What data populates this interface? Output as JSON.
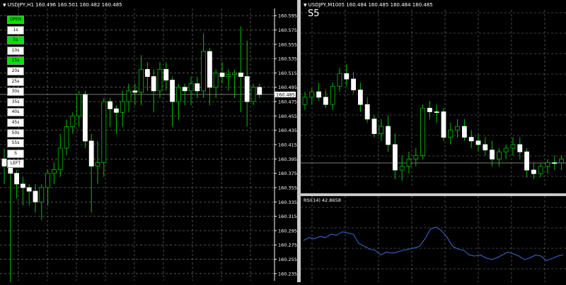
{
  "left_chart": {
    "header": "USDJPY,H1  160.496 160.501 160.482 160.485",
    "current_price": "160.485",
    "price_ticks": [
      "160.595",
      "160.575",
      "160.555",
      "160.535",
      "160.515",
      "160.495",
      "160.475",
      "160.455",
      "160.435",
      "160.415",
      "160.395",
      "160.375",
      "160.355",
      "160.335",
      "160.315",
      "160.295",
      "160.275",
      "160.255",
      "160.235"
    ],
    "timeframe_buttons": [
      {
        "label": "OPEN",
        "active": true
      },
      {
        "label": "1s",
        "active": false
      },
      {
        "label": "5s",
        "active": true
      },
      {
        "label": "10s",
        "active": false
      },
      {
        "label": "15s",
        "active": true
      },
      {
        "label": "20s",
        "active": false
      },
      {
        "label": "25s",
        "active": false
      },
      {
        "label": "30s",
        "active": false
      },
      {
        "label": "35s",
        "active": false
      },
      {
        "label": "40s",
        "active": false
      },
      {
        "label": "45s",
        "active": false
      },
      {
        "label": "50s",
        "active": false
      },
      {
        "label": "55s",
        "active": false
      },
      {
        "label": "S",
        "active": false
      },
      {
        "label": "LEFT",
        "active": false
      }
    ],
    "colors": {
      "bull": "#00c000",
      "bear": "#ffffff",
      "grid": "#808080",
      "price_line": "#a0a0a0"
    }
  },
  "right_chart": {
    "header": "USDJPY,M1005  160.484 160.485 160.484 160.485",
    "label": "S5",
    "rsi_header": "RSI(14) 42.8658",
    "colors": {
      "rsi_line": "#3a6fd8"
    }
  },
  "chart_data": [
    {
      "type": "candlestick",
      "title": "USDJPY,H1",
      "ylim": [
        160.225,
        160.605
      ],
      "candles": [
        {
          "o": 160.395,
          "h": 160.41,
          "l": 160.36,
          "c": 160.385
        },
        {
          "o": 160.385,
          "h": 160.39,
          "l": 160.22,
          "c": 160.375
        },
        {
          "o": 160.375,
          "h": 160.38,
          "l": 160.34,
          "c": 160.36
        },
        {
          "o": 160.36,
          "h": 160.37,
          "l": 160.33,
          "c": 160.355
        },
        {
          "o": 160.355,
          "h": 160.36,
          "l": 160.33,
          "c": 160.35
        },
        {
          "o": 160.35,
          "h": 160.36,
          "l": 160.32,
          "c": 160.335
        },
        {
          "o": 160.335,
          "h": 160.36,
          "l": 160.31,
          "c": 160.355
        },
        {
          "o": 160.355,
          "h": 160.38,
          "l": 160.33,
          "c": 160.375
        },
        {
          "o": 160.375,
          "h": 160.39,
          "l": 160.36,
          "c": 160.38
        },
        {
          "o": 160.38,
          "h": 160.43,
          "l": 160.37,
          "c": 160.41
        },
        {
          "o": 160.41,
          "h": 160.45,
          "l": 160.4,
          "c": 160.44
        },
        {
          "o": 160.44,
          "h": 160.46,
          "l": 160.43,
          "c": 160.455
        },
        {
          "o": 160.455,
          "h": 160.49,
          "l": 160.44,
          "c": 160.485
        },
        {
          "o": 160.485,
          "h": 160.49,
          "l": 160.41,
          "c": 160.42
        },
        {
          "o": 160.42,
          "h": 160.43,
          "l": 160.32,
          "c": 160.385
        },
        {
          "o": 160.385,
          "h": 160.42,
          "l": 160.36,
          "c": 160.39
        },
        {
          "o": 160.39,
          "h": 160.48,
          "l": 160.37,
          "c": 160.475
        },
        {
          "o": 160.475,
          "h": 160.48,
          "l": 160.44,
          "c": 160.465
        },
        {
          "o": 160.465,
          "h": 160.47,
          "l": 160.43,
          "c": 160.46
        },
        {
          "o": 160.46,
          "h": 160.49,
          "l": 160.44,
          "c": 160.475
        },
        {
          "o": 160.475,
          "h": 160.5,
          "l": 160.46,
          "c": 160.49
        },
        {
          "o": 160.49,
          "h": 160.5,
          "l": 160.47,
          "c": 160.488
        },
        {
          "o": 160.488,
          "h": 160.54,
          "l": 160.47,
          "c": 160.52
        },
        {
          "o": 160.52,
          "h": 160.53,
          "l": 160.49,
          "c": 160.51
        },
        {
          "o": 160.51,
          "h": 160.52,
          "l": 160.46,
          "c": 160.49
        },
        {
          "o": 160.49,
          "h": 160.53,
          "l": 160.48,
          "c": 160.52
        },
        {
          "o": 160.52,
          "h": 160.53,
          "l": 160.49,
          "c": 160.505
        },
        {
          "o": 160.505,
          "h": 160.51,
          "l": 160.44,
          "c": 160.475
        },
        {
          "o": 160.475,
          "h": 160.5,
          "l": 160.45,
          "c": 160.495
        },
        {
          "o": 160.495,
          "h": 160.5,
          "l": 160.47,
          "c": 160.49
        },
        {
          "o": 160.49,
          "h": 160.51,
          "l": 160.47,
          "c": 160.5
        },
        {
          "o": 160.5,
          "h": 160.51,
          "l": 160.48,
          "c": 160.49
        },
        {
          "o": 160.49,
          "h": 160.57,
          "l": 160.48,
          "c": 160.545
        },
        {
          "o": 160.545,
          "h": 160.55,
          "l": 160.47,
          "c": 160.495
        },
        {
          "o": 160.495,
          "h": 160.52,
          "l": 160.48,
          "c": 160.515
        },
        {
          "o": 160.515,
          "h": 160.53,
          "l": 160.5,
          "c": 160.51
        },
        {
          "o": 160.51,
          "h": 160.52,
          "l": 160.49,
          "c": 160.513
        },
        {
          "o": 160.513,
          "h": 160.52,
          "l": 160.48,
          "c": 160.515
        },
        {
          "o": 160.515,
          "h": 160.58,
          "l": 160.46,
          "c": 160.51
        },
        {
          "o": 160.51,
          "h": 160.56,
          "l": 160.44,
          "c": 160.475
        },
        {
          "o": 160.475,
          "h": 160.5,
          "l": 160.47,
          "c": 160.495
        },
        {
          "o": 160.495,
          "h": 160.5,
          "l": 160.48,
          "c": 160.485
        }
      ]
    },
    {
      "type": "candlestick",
      "title": "USDJPY,M1005",
      "label": "S5",
      "candles": [
        {
          "o": 0.52,
          "h": 0.45,
          "l": 0.55,
          "c": 0.48
        },
        {
          "o": 0.48,
          "h": 0.43,
          "l": 0.52,
          "c": 0.45
        },
        {
          "o": 0.45,
          "h": 0.4,
          "l": 0.5,
          "c": 0.48
        },
        {
          "o": 0.48,
          "h": 0.44,
          "l": 0.54,
          "c": 0.52
        },
        {
          "o": 0.52,
          "h": 0.4,
          "l": 0.55,
          "c": 0.42
        },
        {
          "o": 0.42,
          "h": 0.32,
          "l": 0.45,
          "c": 0.35
        },
        {
          "o": 0.35,
          "h": 0.3,
          "l": 0.42,
          "c": 0.38
        },
        {
          "o": 0.38,
          "h": 0.34,
          "l": 0.46,
          "c": 0.44
        },
        {
          "o": 0.44,
          "h": 0.4,
          "l": 0.56,
          "c": 0.52
        },
        {
          "o": 0.52,
          "h": 0.48,
          "l": 0.62,
          "c": 0.6
        },
        {
          "o": 0.6,
          "h": 0.58,
          "l": 0.7,
          "c": 0.68
        },
        {
          "o": 0.68,
          "h": 0.6,
          "l": 0.72,
          "c": 0.64
        },
        {
          "o": 0.64,
          "h": 0.58,
          "l": 0.78,
          "c": 0.74
        },
        {
          "o": 0.74,
          "h": 0.68,
          "l": 0.93,
          "c": 0.88
        },
        {
          "o": 0.88,
          "h": 0.8,
          "l": 0.94,
          "c": 0.86
        },
        {
          "o": 0.86,
          "h": 0.78,
          "l": 0.9,
          "c": 0.82
        },
        {
          "o": 0.82,
          "h": 0.76,
          "l": 0.86,
          "c": 0.8
        },
        {
          "o": 0.8,
          "h": 0.52,
          "l": 0.82,
          "c": 0.54
        },
        {
          "o": 0.54,
          "h": 0.5,
          "l": 0.6,
          "c": 0.56
        },
        {
          "o": 0.56,
          "h": 0.52,
          "l": 0.62,
          "c": 0.56
        },
        {
          "o": 0.56,
          "h": 0.54,
          "l": 0.72,
          "c": 0.7
        },
        {
          "o": 0.7,
          "h": 0.62,
          "l": 0.74,
          "c": 0.66
        },
        {
          "o": 0.66,
          "h": 0.6,
          "l": 0.7,
          "c": 0.64
        },
        {
          "o": 0.64,
          "h": 0.6,
          "l": 0.72,
          "c": 0.7
        },
        {
          "o": 0.7,
          "h": 0.66,
          "l": 0.76,
          "c": 0.72
        },
        {
          "o": 0.72,
          "h": 0.68,
          "l": 0.78,
          "c": 0.74
        },
        {
          "o": 0.74,
          "h": 0.7,
          "l": 0.8,
          "c": 0.77
        },
        {
          "o": 0.77,
          "h": 0.72,
          "l": 0.86,
          "c": 0.82
        },
        {
          "o": 0.82,
          "h": 0.76,
          "l": 0.86,
          "c": 0.78
        },
        {
          "o": 0.78,
          "h": 0.74,
          "l": 0.82,
          "c": 0.76
        },
        {
          "o": 0.76,
          "h": 0.7,
          "l": 0.8,
          "c": 0.74
        },
        {
          "o": 0.74,
          "h": 0.7,
          "l": 0.82,
          "c": 0.78
        },
        {
          "o": 0.78,
          "h": 0.76,
          "l": 0.92,
          "c": 0.88
        },
        {
          "o": 0.88,
          "h": 0.84,
          "l": 0.93,
          "c": 0.9
        },
        {
          "o": 0.9,
          "h": 0.84,
          "l": 0.92,
          "c": 0.86
        },
        {
          "o": 0.86,
          "h": 0.82,
          "l": 0.9,
          "c": 0.84
        },
        {
          "o": 0.84,
          "h": 0.8,
          "l": 0.88,
          "c": 0.84
        },
        {
          "o": 0.84,
          "h": 0.8,
          "l": 0.88,
          "c": 0.82
        }
      ]
    },
    {
      "type": "line",
      "title": "RSI(14) 42.8658",
      "values": [
        0.55,
        0.6,
        0.58,
        0.62,
        0.6,
        0.66,
        0.64,
        0.7,
        0.68,
        0.66,
        0.5,
        0.45,
        0.4,
        0.38,
        0.3,
        0.35,
        0.33,
        0.35,
        0.38,
        0.4,
        0.42,
        0.45,
        0.58,
        0.75,
        0.78,
        0.72,
        0.6,
        0.45,
        0.4,
        0.38,
        0.3,
        0.28,
        0.3,
        0.25,
        0.22,
        0.25,
        0.3,
        0.35,
        0.32,
        0.28,
        0.22,
        0.25,
        0.3,
        0.28,
        0.2,
        0.24,
        0.28,
        0.3
      ]
    }
  ]
}
